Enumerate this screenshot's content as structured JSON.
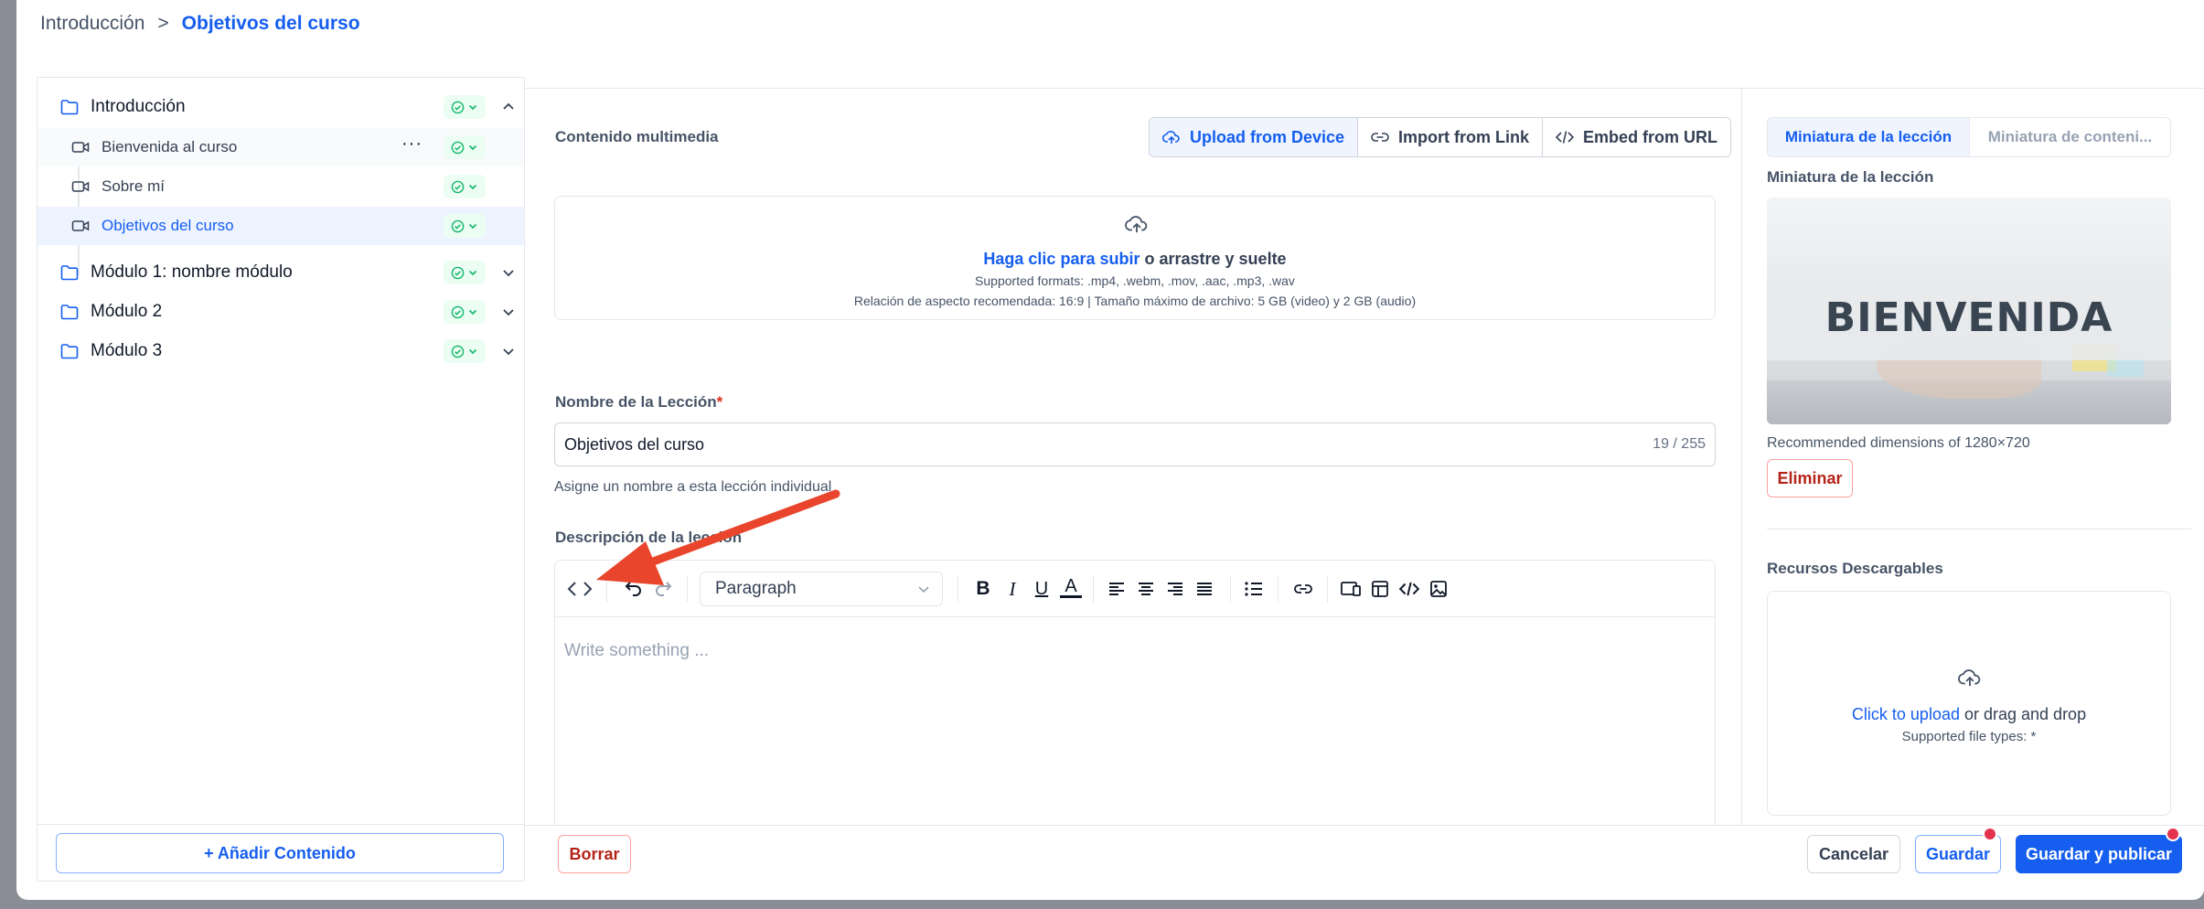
{
  "breadcrumb": {
    "parent": "Introducción",
    "separator": ">",
    "current": "Objetivos del curso"
  },
  "sidebar": {
    "modules": [
      {
        "label": "Introducción",
        "expanded": true
      },
      {
        "label": "Módulo 1: nombre módulo",
        "expanded": false
      },
      {
        "label": "Módulo 2",
        "expanded": false
      },
      {
        "label": "Módulo 3",
        "expanded": false
      }
    ],
    "lessons": [
      {
        "label": "Bienvenida al curso",
        "more": "···"
      },
      {
        "label": "Sobre mí"
      },
      {
        "label": "Objetivos del curso",
        "active": true
      }
    ],
    "add_button": "+ Añadir Contenido"
  },
  "media": {
    "section_label": "Contenido multimedia",
    "tabs": [
      {
        "label": "Upload from Device",
        "active": true,
        "icon": "cloud-upload-icon"
      },
      {
        "label": "Import from Link",
        "icon": "link-icon"
      },
      {
        "label": "Embed from URL",
        "icon": "code-icon"
      }
    ],
    "dropzone": {
      "click_text": "Haga clic para subir",
      "rest_text": " o arrastre y suelte",
      "formats": "Supported formats: .mp4, .webm, .mov, .aac, .mp3, .wav",
      "ratio": "Relación de aspecto recomendada: 16:9 | Tamaño máximo de archivo: 5 GB (video) y 2 GB (audio)"
    }
  },
  "lesson_name": {
    "label": "Nombre de la Lección",
    "required_mark": "*",
    "value": "Objetivos del curso",
    "counter": "19 / 255",
    "hint": "Asigne un nombre a esta lección individual"
  },
  "description": {
    "label": "Descripción de la lección",
    "block_type": "Paragraph",
    "placeholder": "Write something ..."
  },
  "footer": {
    "delete": "Borrar",
    "cancel": "Cancelar",
    "save": "Guardar",
    "publish": "Guardar y publicar"
  },
  "right": {
    "tabs": [
      "Miniatura de la lección",
      "Miniatura de conteni..."
    ],
    "thumb_label": "Miniatura de la lección",
    "thumb_word": "BIENVENIDA",
    "dimensions": "Recommended dimensions of 1280×720",
    "remove": "Eliminar",
    "resources_label": "Recursos Descargables",
    "upload_click": "Click to upload",
    "upload_rest": " or drag and drop",
    "file_types": "Supported file types: *"
  },
  "colors": {
    "accent": "#155eef",
    "danger": "#b42318",
    "success": "#12b76a",
    "annotation": "#e8452c"
  }
}
